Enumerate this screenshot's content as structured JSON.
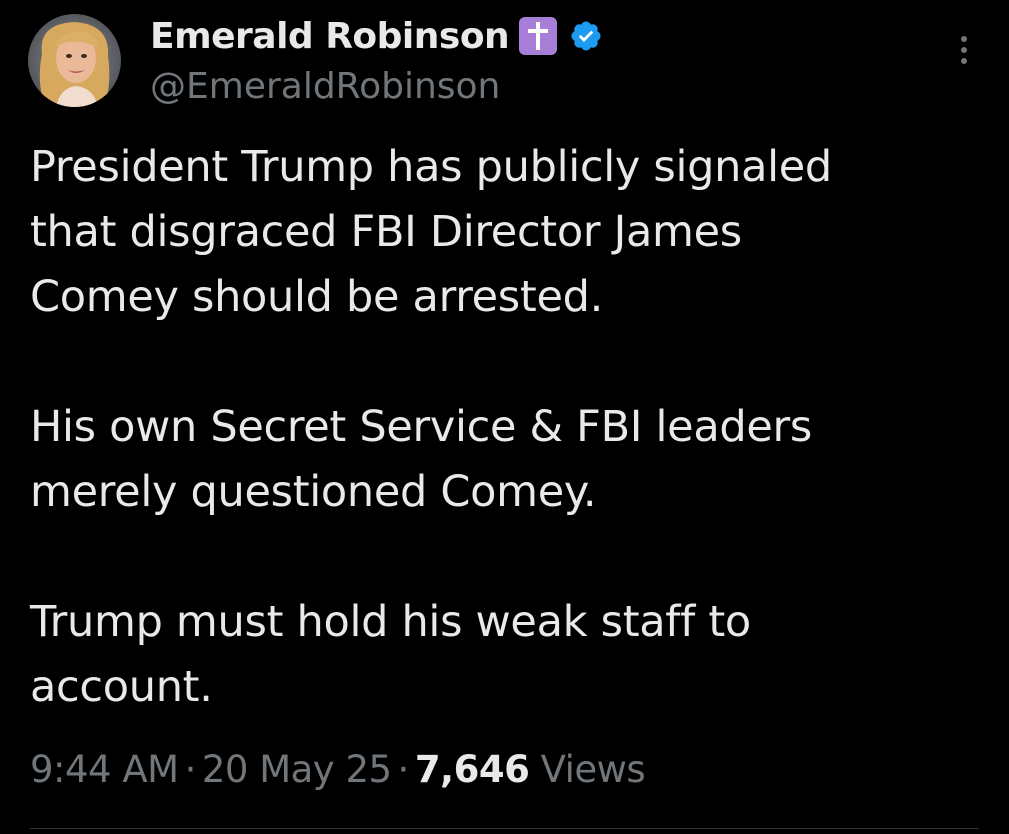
{
  "author": {
    "display_name": "Emerald Robinson",
    "handle": "@EmeraldRobinson",
    "name_emoji": "latin-cross-icon",
    "verified": true
  },
  "tweet": {
    "paragraphs": [
      "President Trump has publicly signaled\nthat disgraced FBI Director James\nComey should be arrested.",
      "His own Secret Service & FBI leaders\nmerely questioned Comey.",
      "Trump must hold his weak staff to\naccount."
    ],
    "time": "9:44 AM",
    "date": "20 May 25",
    "views_count": "7,646",
    "views_label": "Views",
    "separator": "·"
  },
  "colors": {
    "background": "#000000",
    "text_primary": "#e7e9ea",
    "text_secondary": "#71767b",
    "verified_blue": "#1d9bf0",
    "emoji_purple": "#a77fd8"
  },
  "icons": {
    "more": "more-vertical-icon",
    "verified": "verified-badge-icon",
    "emoji": "latin-cross-icon"
  }
}
